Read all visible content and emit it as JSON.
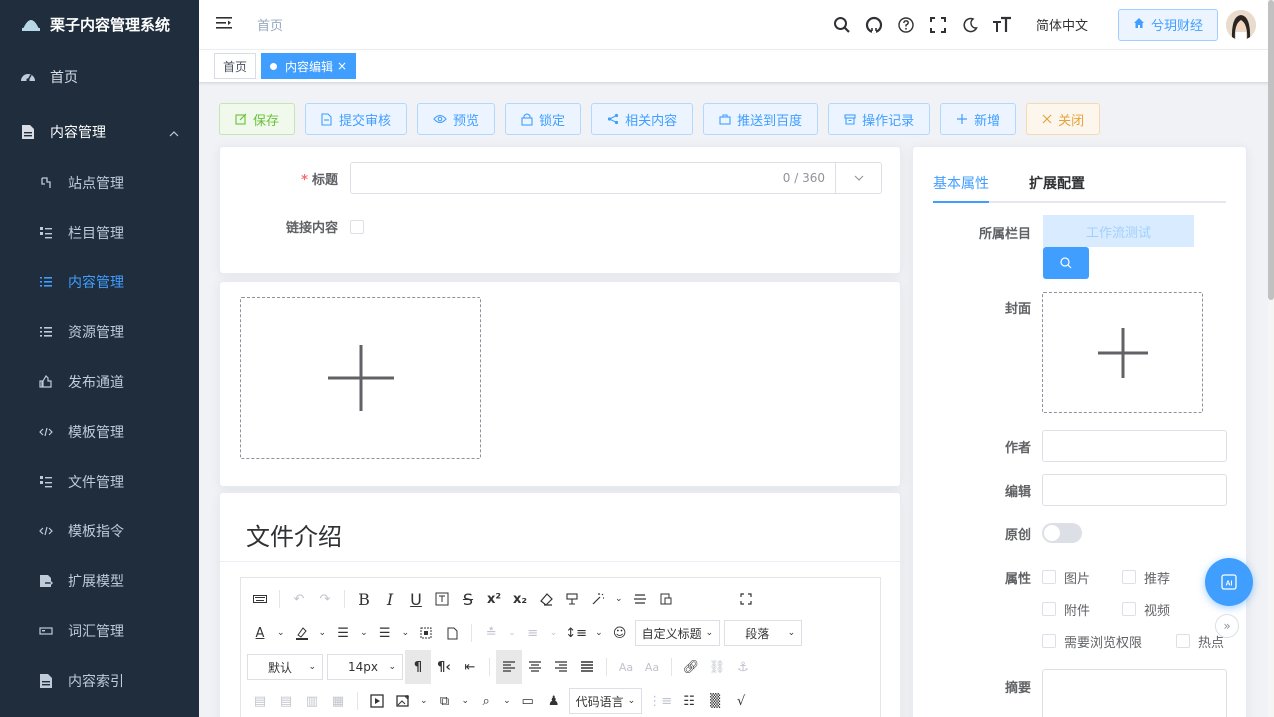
{
  "app": {
    "title": "栗子内容管理系统"
  },
  "sidebar": {
    "items": [
      {
        "label": "首页"
      },
      {
        "label": "内容管理"
      },
      {
        "label": "站点管理"
      },
      {
        "label": "栏目管理"
      },
      {
        "label": "内容管理"
      },
      {
        "label": "资源管理"
      },
      {
        "label": "发布通道"
      },
      {
        "label": "模板管理"
      },
      {
        "label": "文件管理"
      },
      {
        "label": "模板指令"
      },
      {
        "label": "扩展模型"
      },
      {
        "label": "词汇管理"
      },
      {
        "label": "内容索引"
      }
    ]
  },
  "navbar": {
    "breadcrumb": "首页",
    "language": "简体中文",
    "site": "兮玥财经"
  },
  "tags": [
    {
      "label": "首页"
    },
    {
      "label": "内容编辑"
    }
  ],
  "toolbar": {
    "save": "保存",
    "submit": "提交审核",
    "preview": "预览",
    "lock": "锁定",
    "related": "相关内容",
    "baidu": "推送到百度",
    "log": "操作记录",
    "add": "新增",
    "close": "关闭"
  },
  "form": {
    "title_label": "标题",
    "title_count": "0 / 360",
    "link_label": "链接内容"
  },
  "editor": {
    "heading": "文件介绍",
    "custom_title": "自定义标题",
    "paragraph": "段落",
    "font": "默认",
    "size": "14px",
    "code_lang": "代码语言"
  },
  "panel": {
    "tabs": [
      "基本属性",
      "扩展配置"
    ],
    "catalog_label": "所属栏目",
    "catalog_value": "工作流测试",
    "cover_label": "封面",
    "author_label": "作者",
    "editor_label": "编辑",
    "original_label": "原创",
    "attr_label": "属性",
    "attrs": [
      "图片",
      "推荐",
      "附件",
      "视频",
      "需要浏览权限",
      "热点"
    ],
    "summary_label": "摘要"
  },
  "colors": {
    "primary": "#409eff",
    "sidebar": "#1f2d3d",
    "success": "#67c23a",
    "warning": "#e6a23c"
  }
}
